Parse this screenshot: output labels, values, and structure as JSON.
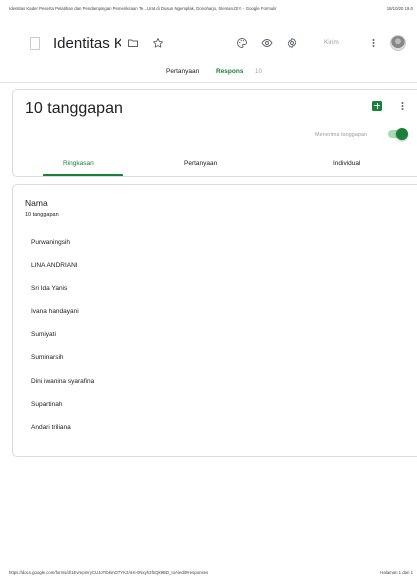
{
  "print": {
    "header_title": "Identitas Kader Peserta Pelatihan dan Pendampingan Pemeriksaan Te...Urat di Dusun Ngemplak, Donoharjo, Sleman,DIY. - Google Formulir",
    "header_date": "18/10/20 19.0",
    "footer_url": "https://docs.google.com/forms/d/1EvrepmryCUJoTIbkmO7YK2AHt-0Nxyh3fnQk9BD_IoA/edit#responses",
    "footer_page": "Halaman 1 dari 1"
  },
  "topbar": {
    "title": "Identitas Kader Peserta Pelatihan",
    "send_label": "Kirim"
  },
  "tabs": {
    "questions": "Pertanyaan",
    "responses": "Respons",
    "responses_count": "10"
  },
  "summary_card": {
    "title": "10 tanggapan",
    "accepting_label": "Menerima tanggapan",
    "accepting_on": true,
    "subtabs": {
      "summary": "Ringkasan",
      "question": "Pertanyaan",
      "individual": "Individual"
    }
  },
  "question_card": {
    "title": "Nama",
    "count": "10 tanggapan",
    "answers": [
      "Purwaningsih",
      "LINA ANDRIANI",
      "Sri Ida Yanis",
      "Ivana handayani",
      "Sumiyati",
      "Suminarsih",
      "Dini iwanina syarafina",
      "Supartinah",
      "Andari triliana"
    ]
  },
  "colors": {
    "accent": "#188038",
    "muted": "#9aa0a6",
    "border": "#dadce0"
  },
  "icons": [
    "form-icon",
    "folder-icon",
    "star-icon",
    "palette-icon",
    "eye-icon",
    "gear-icon",
    "more-vert-icon",
    "sheets-icon"
  ]
}
